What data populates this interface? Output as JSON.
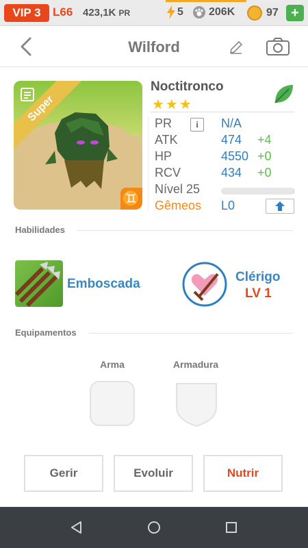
{
  "status_bar": {
    "vip": "VIP 3",
    "level": "L66",
    "power": "423,1K",
    "power_unit": "PR",
    "energy": "5",
    "paws": "206K",
    "coins": "97",
    "plus": "+",
    "energy_color": "#f5a623"
  },
  "header": {
    "title": "Wilford",
    "back_icon": "chevron-left-icon",
    "edit_icon": "pencil-icon",
    "camera_icon": "camera-icon"
  },
  "monster": {
    "name": "Noctitronco",
    "rarity": "Super",
    "stars": "★★★",
    "star_count": 3,
    "element_icon": "leaf-icon",
    "stats": {
      "pr_label": "PR",
      "pr_value": "N/A",
      "atk_label": "ATK",
      "atk_value": "474",
      "atk_bonus": "+4",
      "hp_label": "HP",
      "hp_value": "4550",
      "hp_bonus": "+0",
      "rcv_label": "RCV",
      "rcv_value": "434",
      "rcv_bonus": "+0",
      "level_label": "Nível 25",
      "twins_label": "Gêmeos",
      "twins_value": "L0",
      "info_label": "i"
    }
  },
  "abilities": {
    "heading": "Habilidades",
    "skill_name": "Emboscada",
    "class_name": "Clérigo",
    "class_level": "LV 1"
  },
  "equipment": {
    "heading": "Equipamentos",
    "weapon_label": "Arma",
    "armor_label": "Armadura"
  },
  "actions": {
    "manage": "Gerir",
    "evolve": "Evoluir",
    "feed": "Nutrir"
  },
  "colors": {
    "accent_orange": "#e8471c",
    "stat_blue": "#2d7fc1",
    "bonus_green": "#5cbf4a",
    "twins_orange": "#f28a1a"
  }
}
